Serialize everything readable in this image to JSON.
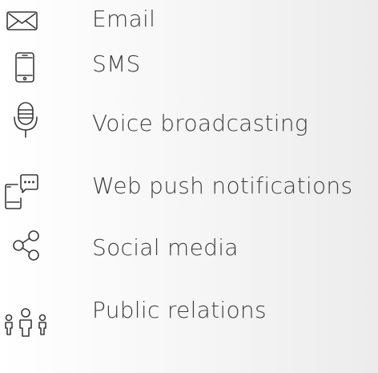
{
  "channels": {
    "items": [
      {
        "icon": "envelope-icon",
        "label": "Email"
      },
      {
        "icon": "smartphone-icon",
        "label": "SMS"
      },
      {
        "icon": "microphone-icon",
        "label": "Voice broadcasting"
      },
      {
        "icon": "push-notification-icon",
        "label": "Web push notifications"
      },
      {
        "icon": "share-icon",
        "label": "Social media"
      },
      {
        "icon": "people-group-icon",
        "label": "Public relations"
      }
    ]
  },
  "colors": {
    "text": "#3f3f3f",
    "icon_stroke": "#3a3a3a",
    "background_start": "#ffffff",
    "background_end": "#ececec"
  }
}
